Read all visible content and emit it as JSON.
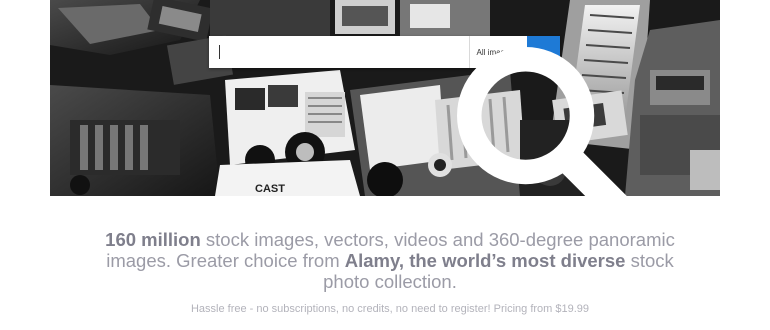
{
  "search": {
    "value": "",
    "category_label": "All images",
    "button_icon": "search-icon"
  },
  "hero": {
    "image": "black-and-white-toy-trucks-photo",
    "truck_text": "CAST"
  },
  "headline": {
    "p1_bold": "160 million",
    "p2": " stock images, vectors, videos and 360-degree panoramic images. Greater choice from ",
    "p3_bold": "Alamy, the world’s most diverse",
    "p4": " stock photo collection."
  },
  "subline": "Hassle free - no subscriptions, no credits, no need to register! Pricing from $19.99",
  "colors": {
    "accent": "#1e7ad6",
    "headline_text": "#9b9ba6",
    "subline_text": "#b3b3bb"
  }
}
